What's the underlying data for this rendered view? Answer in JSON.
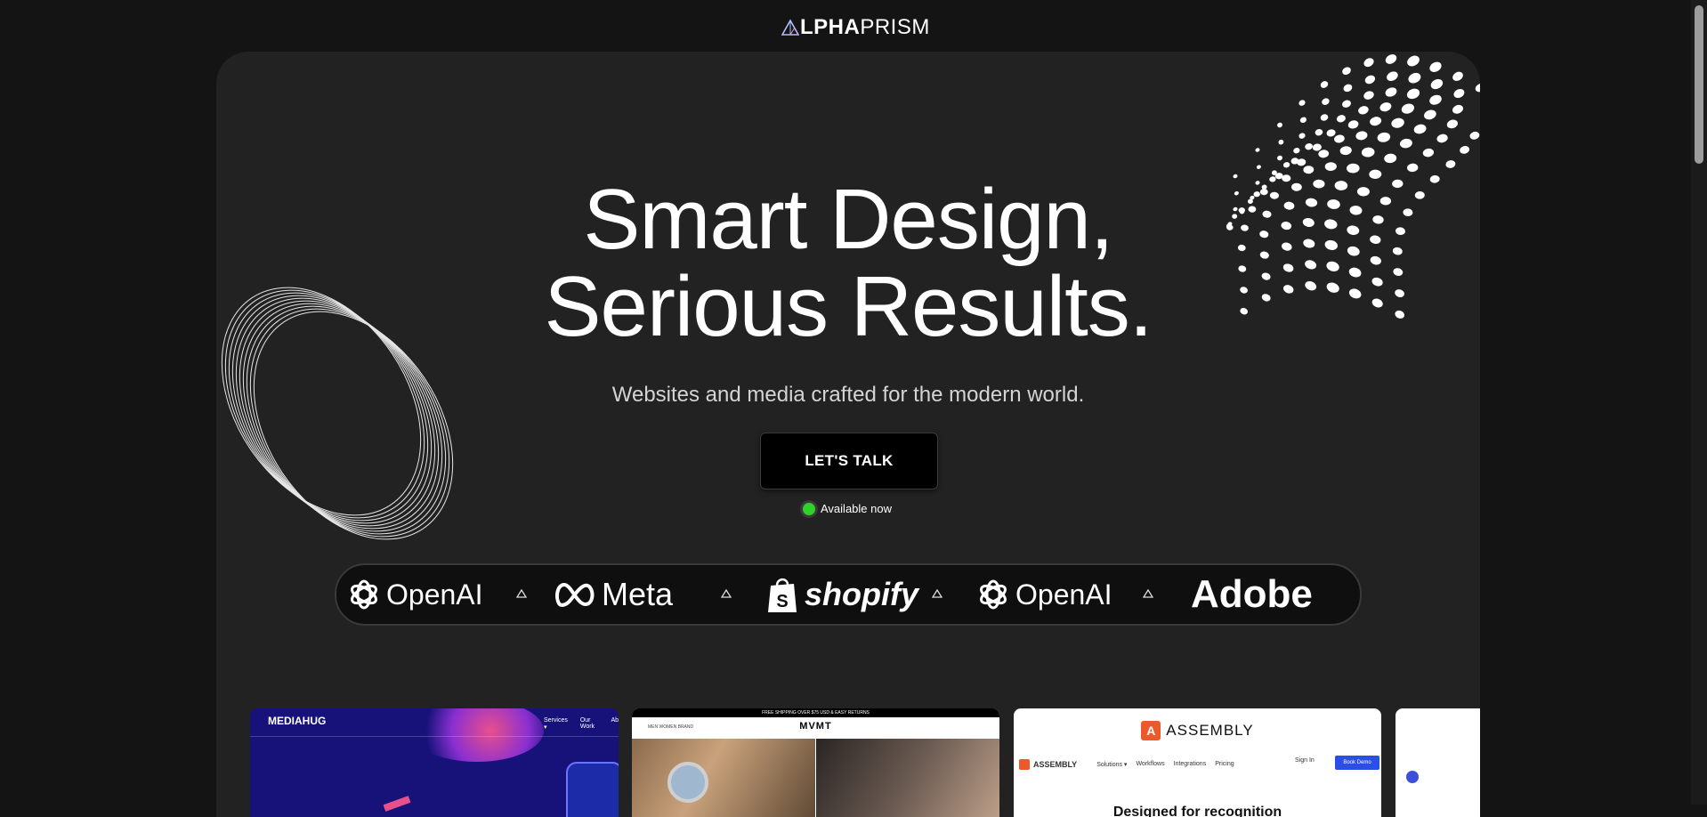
{
  "header": {
    "logo_bold": "LPHA",
    "logo_thin": "PRISM"
  },
  "hero": {
    "title_line1": "Smart Design,",
    "title_line2": "Serious Results.",
    "subtitle": "Websites and media crafted for the modern world.",
    "cta_label": "LET'S TALK",
    "status_text": "Available now",
    "status_color": "#2fd12a"
  },
  "clients": [
    {
      "name": "OpenAI",
      "icon": "openai-icon"
    },
    {
      "name": "Meta",
      "icon": "meta-infinity-icon"
    },
    {
      "name": "shopify",
      "icon": "shopify-bag-icon"
    },
    {
      "name": "OpenAI",
      "icon": "openai-icon"
    },
    {
      "name": "Adobe",
      "icon": "adobe-icon"
    }
  ],
  "portfolio": {
    "mediahug": {
      "logo": "MEDIAHUG",
      "nav": [
        "Services ▾",
        "Our Work",
        "Ab"
      ]
    },
    "mvmt": {
      "promo": "FREE SHIPPING OVER $75 USD & EASY RETURNS",
      "brand": "MVMT",
      "nav": "MEN   WOMEN   BRAND"
    },
    "assembly": {
      "brand": "ASSEMBLY",
      "nav_brand": "ASSEMBLY",
      "links": [
        "Solutions ▾",
        "Workflows",
        "Integrations",
        "Pricing"
      ],
      "signin": "Sign In",
      "demo": "Book Demo",
      "headline": "Designed for recognition"
    }
  },
  "colors": {
    "background": "#141414",
    "card": "#222222",
    "accent_green": "#2fd12a"
  }
}
